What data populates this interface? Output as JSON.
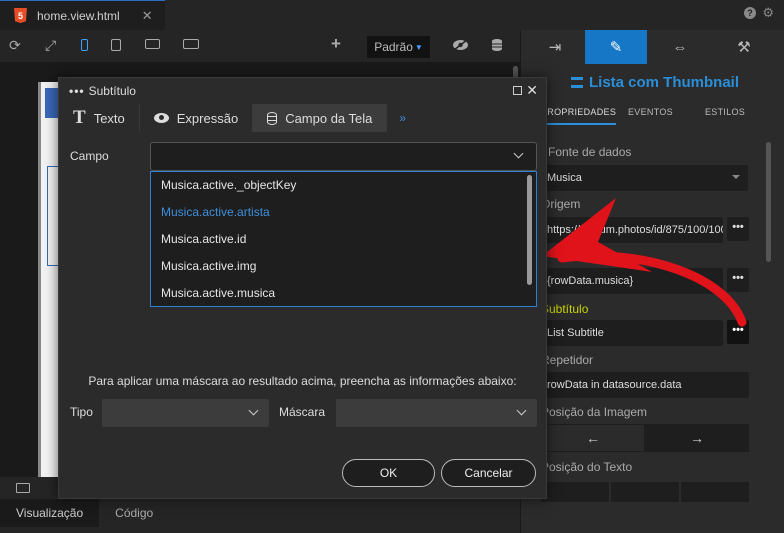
{
  "tabbar": {
    "file_name": "home.view.html",
    "file_badge": "5",
    "close_glyph": "✕",
    "help_glyph": "?"
  },
  "toolbar": {
    "mode_label": "Padrão"
  },
  "bottom": {
    "tabs": [
      {
        "label": "Visualização",
        "active": true
      },
      {
        "label": "Código",
        "active": false
      }
    ]
  },
  "panel": {
    "title": "Lista com Thumbnail",
    "tabs": [
      "PROPRIEDADES",
      "EVENTOS",
      "ESTILOS"
    ],
    "fonte_label": "Fonte de dados",
    "fonte_value": "Musica",
    "origem_label": "Origem",
    "origem_value": "https://picsum.photos/id/875/100/100",
    "row_value": "{rowData.musica}",
    "subtitulo_label": "Subtítulo",
    "subtitulo_value": "List Subtitle",
    "repetidor_label": "Repetidor",
    "repetidor_value": "rowData in datasource.data",
    "posicao_imagem_label": "Posição da Imagem",
    "arrow_left": "←",
    "arrow_right": "→",
    "posicao_texto_label": "Posição do Texto",
    "dots": "•••"
  },
  "modal": {
    "title": "Subtítulo",
    "tabs": [
      "Texto",
      "Expressão",
      "Campo da Tela"
    ],
    "more_glyph": "»",
    "campo_label": "Campo",
    "options": [
      {
        "label": "Musica.active._objectKey",
        "highlight": false
      },
      {
        "label": "Musica.active.artista",
        "highlight": true
      },
      {
        "label": "Musica.active.id",
        "highlight": false
      },
      {
        "label": "Musica.active.img",
        "highlight": false
      },
      {
        "label": "Musica.active.musica",
        "highlight": false
      }
    ],
    "mask_hint": "Para aplicar uma máscara ao resultado acima, preencha as informações abaixo:",
    "tipo_label": "Tipo",
    "mascara_label": "Máscara",
    "ok_label": "OK",
    "cancel_label": "Cancelar"
  },
  "colors": {
    "accent": "#2a8fd8",
    "active_tool": "#1577c5",
    "subtitle_label": "#c8d400",
    "annotation_arrow": "#e0121a"
  }
}
